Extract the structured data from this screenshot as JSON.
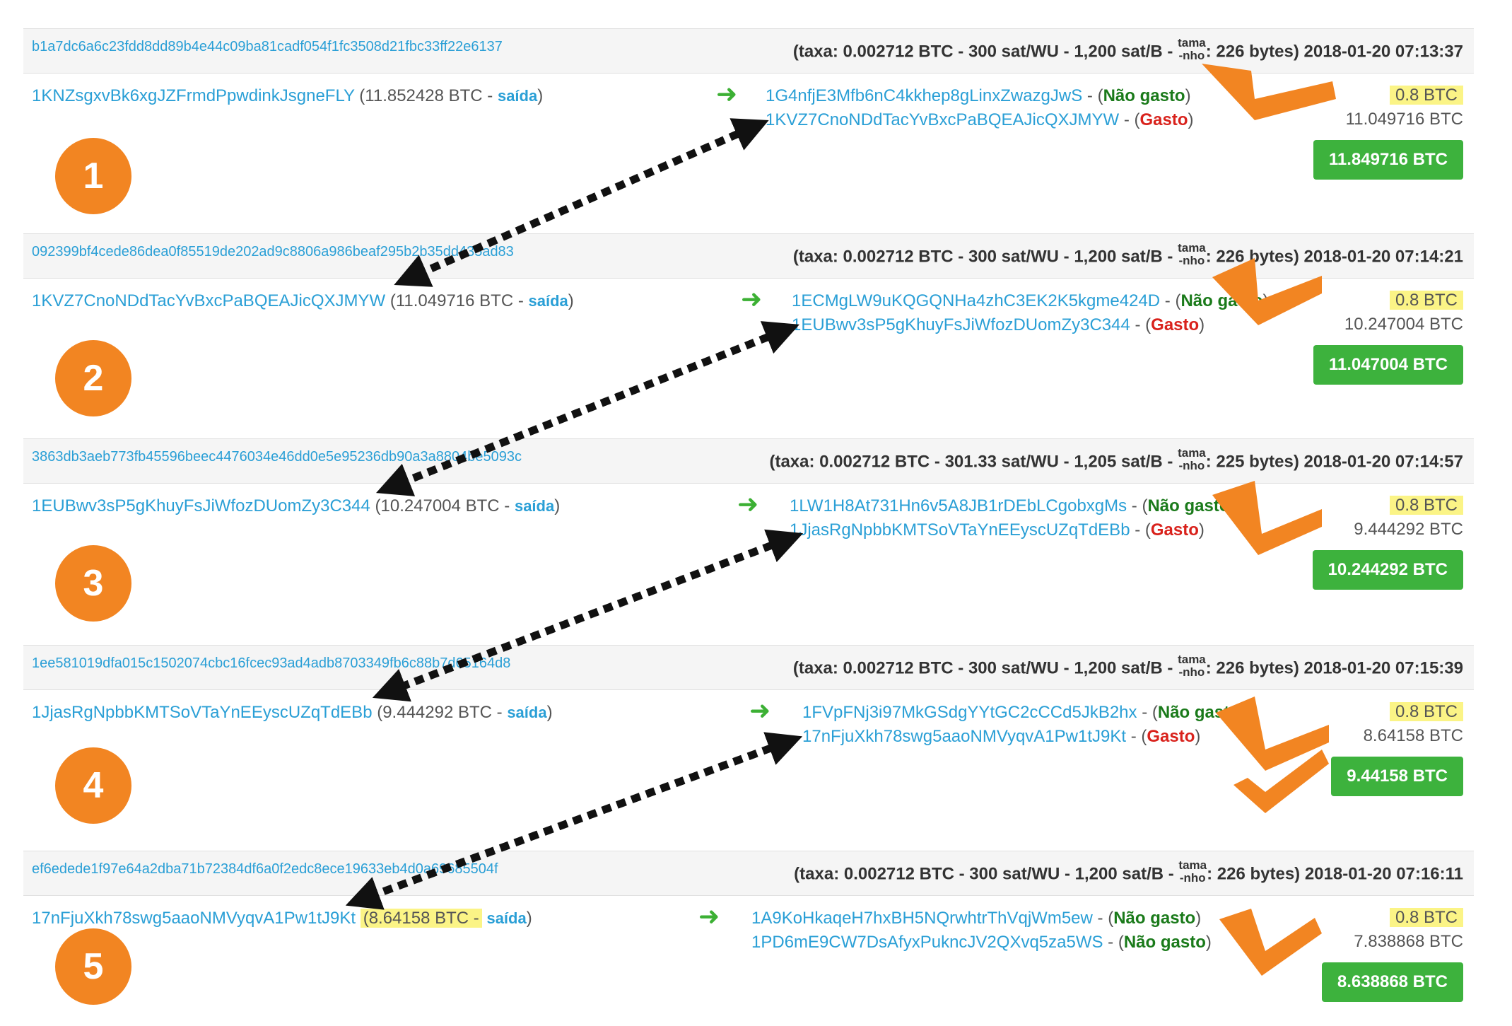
{
  "labels": {
    "saida": "saída",
    "nao_gasto": "Não gasto",
    "gasto": "Gasto",
    "size_top": "tama",
    "size_bottom": "-nho"
  },
  "colors": {
    "link": "#2a9fd6",
    "unspent": "#1a7a1a",
    "spent": "#d9221c",
    "total_badge": "#3db23d",
    "highlight": "#fbf486",
    "marker": "#f28522",
    "step_number": "#f28522"
  },
  "transactions": [
    {
      "step": "1",
      "hash": "b1a7dc6a6c23fdd8dd89b4e44c09ba81cadf054f1fc3508d21fbc33ff22e6137",
      "meta_prefix": "(taxa: 0.002712 BTC - 300 sat/WU - 1,200 sat/B -",
      "meta_suffix": ": 226 bytes) 2018-01-20 07:13:37",
      "input_address": "1KNZsgxvBk6xgJZFrmdPpwdinkJsgneFLY",
      "input_amount": "(11.852428 BTC -",
      "input_close": ")",
      "outputs": [
        {
          "address": "1G4nfjE3Mfb6nC4kkhep8gLinxZwazgJwS",
          "sep": " - (",
          "status": "Não gasto",
          "close": ")",
          "amount": "0.8 BTC"
        },
        {
          "address": "1KVZ7CnoNDdTacYvBxcPaBQEAJicQXJMYW",
          "sep": " - (",
          "status": "Gasto",
          "close": ")",
          "amount": "11.049716 BTC"
        }
      ],
      "total": "11.849716 BTC"
    },
    {
      "step": "2",
      "hash": "092399bf4cede86dea0f85519de202ad9c8806a986beaf295b2b35dd435ad83",
      "meta_prefix": "(taxa: 0.002712 BTC - 300 sat/WU - 1,200 sat/B -",
      "meta_suffix": ": 226 bytes) 2018-01-20 07:14:21",
      "input_address": "1KVZ7CnoNDdTacYvBxcPaBQEAJicQXJMYW",
      "input_amount": "(11.049716 BTC -",
      "input_close": ")",
      "outputs": [
        {
          "address": "1ECMgLW9uKQGQNHa4zhC3EK2K5kgme424D",
          "sep": " - (",
          "status": "Não gasto",
          "close": ")",
          "amount": "0.8 BTC"
        },
        {
          "address": "1EUBwv3sP5gKhuyFsJiWfozDUomZy3C344",
          "sep": " - (",
          "status": "Gasto",
          "close": ")",
          "amount": "10.247004 BTC"
        }
      ],
      "total": "11.047004 BTC"
    },
    {
      "step": "3",
      "hash": "3863db3aeb773fb45596beec4476034e46dd0e5e95236db90a3a8804be5093c",
      "meta_prefix": "(taxa: 0.002712 BTC - 301.33 sat/WU - 1,205 sat/B -",
      "meta_suffix": ": 225 bytes) 2018-01-20 07:14:57",
      "input_address": "1EUBwv3sP5gKhuyFsJiWfozDUomZy3C344",
      "input_amount": "(10.247004 BTC -",
      "input_close": ")",
      "outputs": [
        {
          "address": "1LW1H8At731Hn6v5A8JB1rDEbLCgobxgMs",
          "sep": " - (",
          "status": "Não gasto",
          "close": ")",
          "amount": "0.8 BTC"
        },
        {
          "address": "1JjasRgNpbbKMTSoVTaYnEEyscUZqTdEBb",
          "sep": " - (",
          "status": "Gasto",
          "close": ")",
          "amount": "9.444292 BTC"
        }
      ],
      "total": "10.244292 BTC"
    },
    {
      "step": "4",
      "hash": "1ee581019dfa015c1502074cbc16fcec93ad4adb8703349fb6c88b7d65164d8",
      "meta_prefix": "(taxa: 0.002712 BTC - 300 sat/WU - 1,200 sat/B -",
      "meta_suffix": ": 226 bytes) 2018-01-20 07:15:39",
      "input_address": "1JjasRgNpbbKMTSoVTaYnEEyscUZqTdEBb",
      "input_amount": "(9.444292 BTC -",
      "input_close": ")",
      "outputs": [
        {
          "address": "1FVpFNj3i97MkGSdgYYtGC2cCCd5JkB2hx",
          "sep": " - (",
          "status": "Não gasto",
          "close": ")",
          "amount": "0.8 BTC"
        },
        {
          "address": "17nFjuXkh78swg5aaoNMVyqvA1Pw1tJ9Kt",
          "sep": " - (",
          "status": "Gasto",
          "close": ")",
          "amount": "8.64158 BTC"
        }
      ],
      "total": "9.44158 BTC"
    },
    {
      "step": "5",
      "hash": "ef6edede1f97e64a2dba71b72384df6a0f2edc8ece19633eb4d0a69685504f",
      "meta_prefix": "(taxa: 0.002712 BTC - 300 sat/WU - 1,200 sat/B -",
      "meta_suffix": ": 226 bytes) 2018-01-20 07:16:11",
      "input_address": "17nFjuXkh78swg5aaoNMVyqvA1Pw1tJ9Kt",
      "input_amount": "(8.64158 BTC -",
      "input_close": ")",
      "outputs": [
        {
          "address": "1A9KoHkaqeH7hxBH5NQrwhtrThVqjWm5ew",
          "sep": " - (",
          "status": "Não gasto",
          "close": ")",
          "amount": "0.8 BTC"
        },
        {
          "address": "1PD6mE9CW7DsAfyxPukncJV2QXvq5za5WS",
          "sep": " - (",
          "status": "Não gasto",
          "close": ")",
          "amount": "7.838868 BTC"
        }
      ],
      "total": "8.638868 BTC"
    }
  ]
}
